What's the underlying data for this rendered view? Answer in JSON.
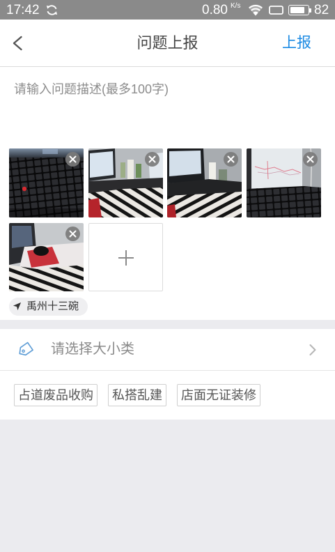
{
  "status_bar": {
    "time": "17:42",
    "network_speed": "0.80",
    "network_speed_unit": "K/s",
    "battery_level": "82"
  },
  "header": {
    "title": "问题上报",
    "submit_label": "上报"
  },
  "description": {
    "value": "",
    "placeholder": "请输入问题描述(最多100字)"
  },
  "location": {
    "name": "禹州十三碗"
  },
  "category": {
    "placeholder": "请选择大小类"
  },
  "quick_tags": [
    "占道废品收购",
    "私搭乱建",
    "店面无证装修"
  ],
  "icons": {
    "status_sync": "sync-icon",
    "status_wifi": "wifi-icon",
    "status_screen": "screen-icon",
    "status_battery": "battery-icon",
    "back": "chevron-left-icon",
    "remove_photo": "close-icon",
    "add_photo": "plus-icon",
    "location": "location-arrow-icon",
    "category": "tag-icon",
    "category_open": "chevron-right-icon"
  },
  "colors": {
    "accent": "#1b8ae3",
    "status_bar_bg": "#8a8a8a",
    "page_bg": "#ebebef"
  }
}
